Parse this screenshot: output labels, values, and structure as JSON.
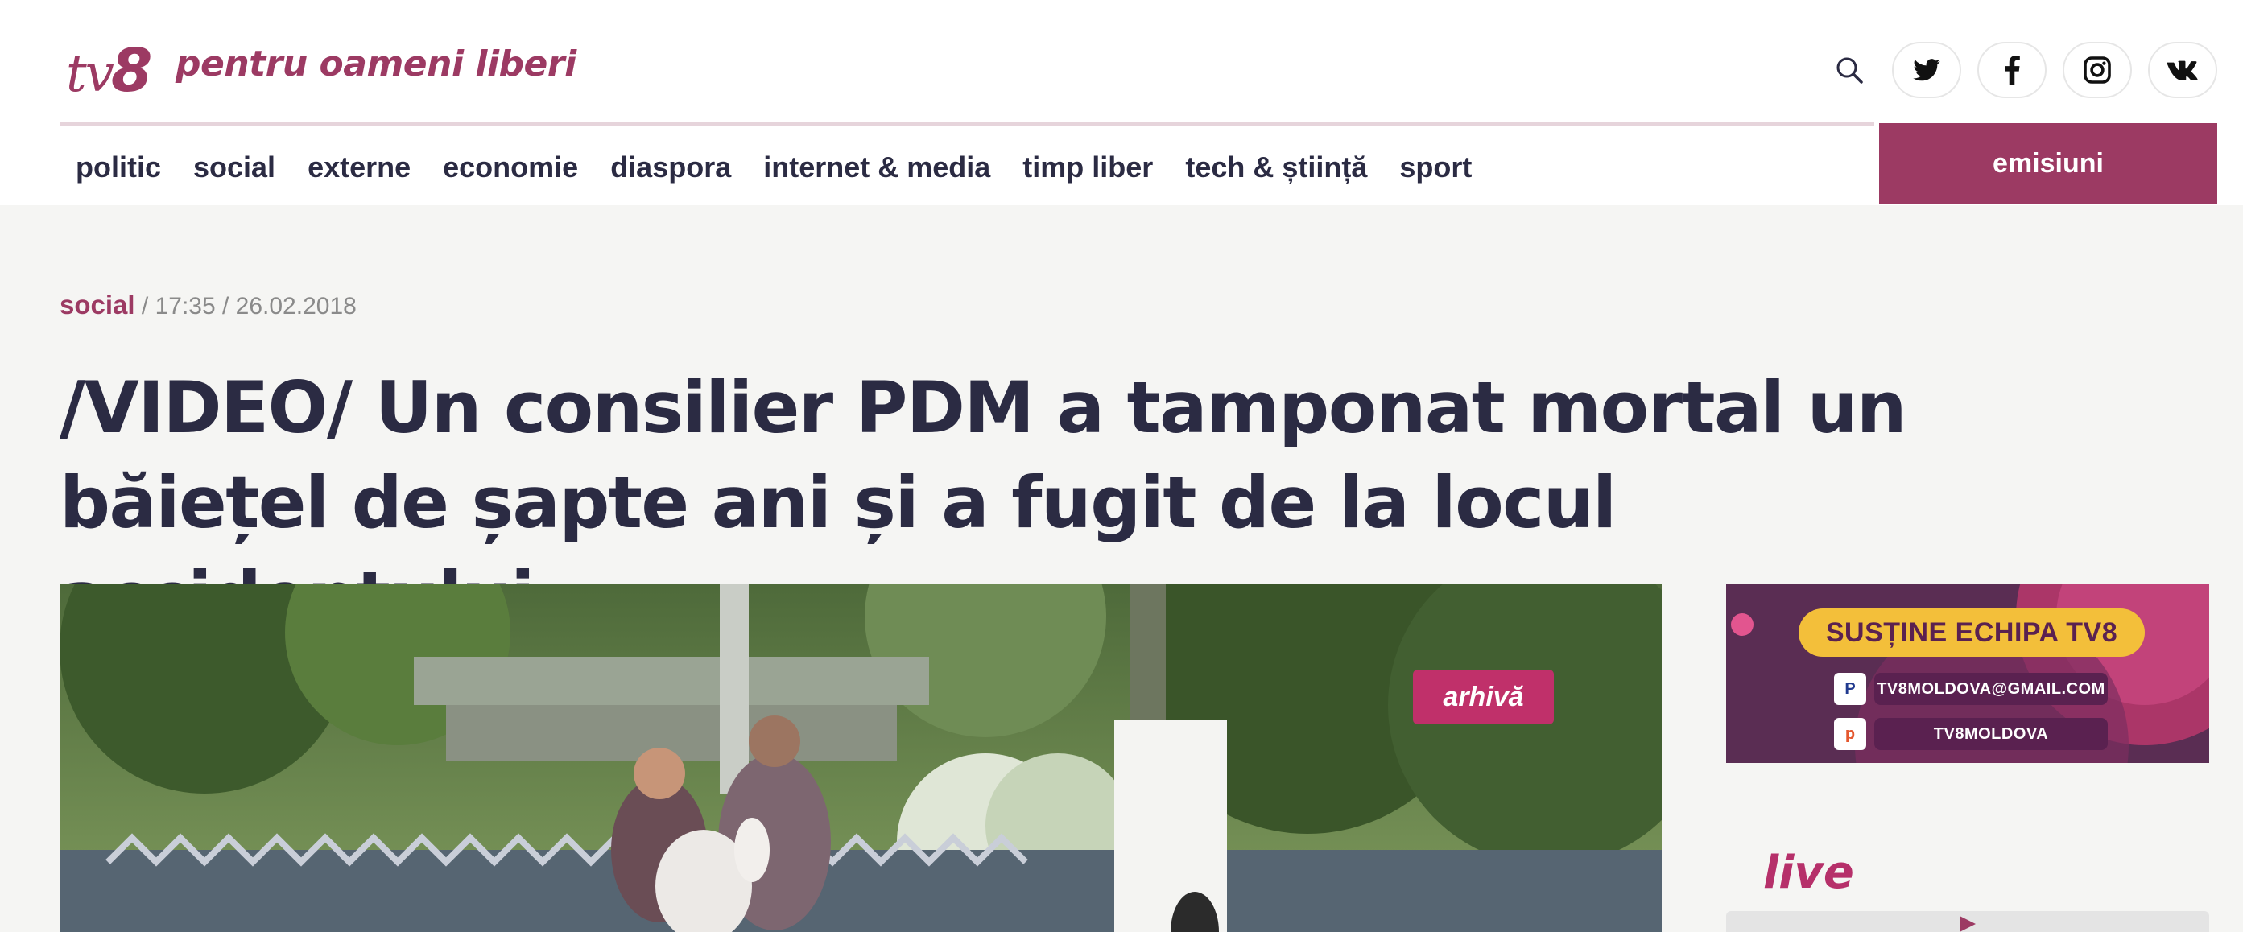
{
  "header": {
    "logo_tv": "tv",
    "logo_8": "8",
    "slogan": "pentru oameni liberi",
    "icons": [
      "search-icon",
      "twitter-icon",
      "facebook-icon",
      "instagram-icon",
      "vk-icon"
    ]
  },
  "nav": {
    "items": [
      "politic",
      "social",
      "externe",
      "economie",
      "diaspora",
      "internet & media",
      "timp liber",
      "tech & știință",
      "sport"
    ],
    "cta": "emisiuni"
  },
  "article": {
    "category": "social",
    "time": "17:35",
    "date": "26.02.2018",
    "title": "/VIDEO/ Un consilier PDM a tamponat mortal un băiețel de șapte ani și a fugit de la locul accidentului",
    "video_badge": "arhivă"
  },
  "sidebar": {
    "banner_title": "SUSȚINE ECHIPA TV8",
    "banner_email": "TV8MOLDOVA@GMAIL.COM",
    "banner_patreon": "TV8MOLDOVA",
    "live_label": "live"
  },
  "colors": {
    "brand": "#9c3a63",
    "text": "#2b2b43",
    "background": "#f5f5f3"
  }
}
